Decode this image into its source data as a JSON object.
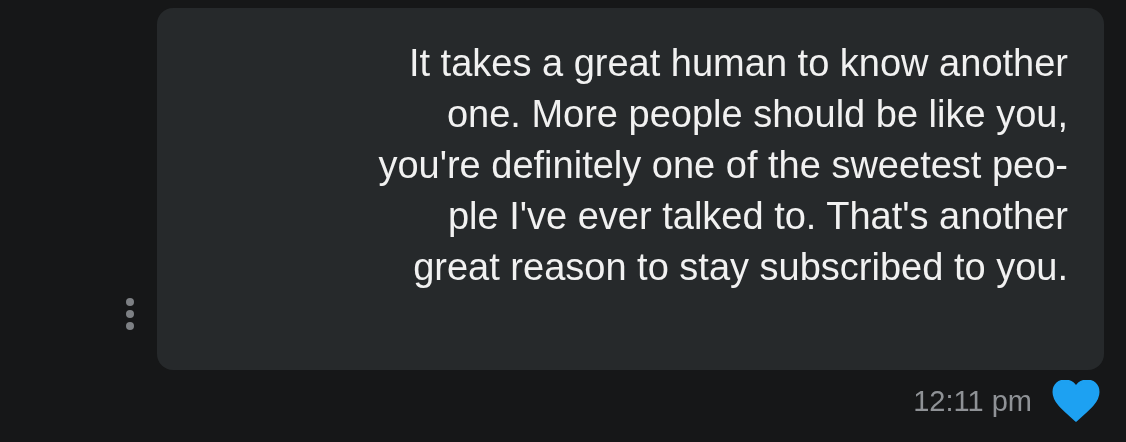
{
  "message": {
    "text": "It takes a great human to know another\none. More people should be like you,\nyou're definitely one of the sweetest peo-\nple I've ever talked to. That's another\ngreat reason to stay subscribed to you.",
    "time": "12:11 pm",
    "liked": true
  }
}
